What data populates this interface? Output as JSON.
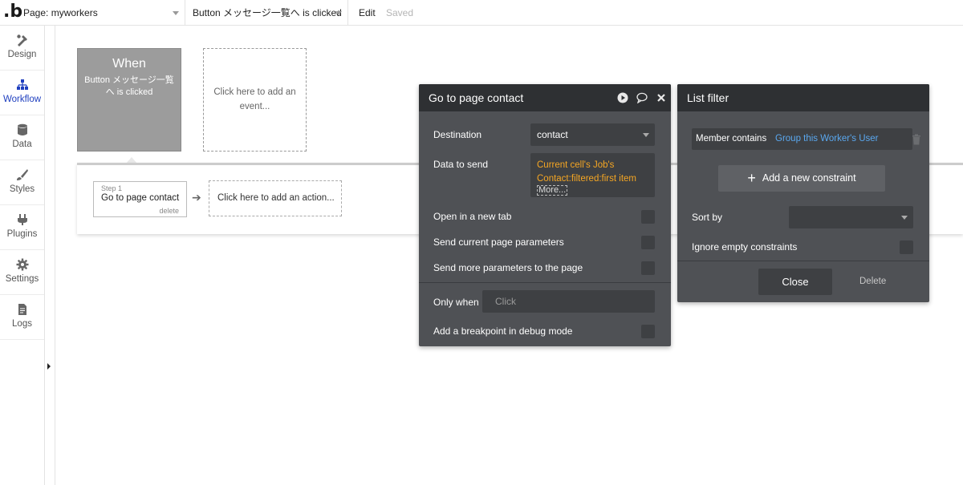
{
  "topbar": {
    "logo": ".b",
    "page_select": "Page: myworkers",
    "event_select": "Button メッセージ一覧へ is clicked",
    "edit_label": "Edit",
    "saved_label": "Saved"
  },
  "sidebar": {
    "items": [
      {
        "label": "Design",
        "icon": "design-icon"
      },
      {
        "label": "Workflow",
        "icon": "workflow-icon",
        "active": true
      },
      {
        "label": "Data",
        "icon": "database-icon"
      },
      {
        "label": "Styles",
        "icon": "brush-icon"
      },
      {
        "label": "Plugins",
        "icon": "plug-icon"
      },
      {
        "label": "Settings",
        "icon": "gear-icon"
      },
      {
        "label": "Logs",
        "icon": "document-icon"
      }
    ]
  },
  "canvas": {
    "event_when": "When",
    "event_name": "Button メッセージ一覧へ is clicked",
    "add_event": "Click here to add an event...",
    "step_number": "Step 1",
    "step_name": "Go to page contact",
    "step_delete": "delete",
    "add_action": "Click here to add an action..."
  },
  "action_panel": {
    "title": "Go to page contact",
    "destination_label": "Destination",
    "destination_value": "contact",
    "data_label": "Data to send",
    "data_value_line1": "Current cell's Job's",
    "data_value_line2": "Contact:filtered:first item",
    "data_more": "More...",
    "open_new_tab": "Open in a new tab",
    "send_params": "Send current page parameters",
    "send_more_params": "Send more parameters to the page",
    "only_when_label": "Only when",
    "only_when_placeholder": "Click",
    "breakpoint": "Add a breakpoint in debug mode"
  },
  "filter_panel": {
    "title": "List filter",
    "constraint_key": "Member contains",
    "constraint_value": "Group this Worker's User",
    "add_constraint": "Add a new constraint",
    "sort_by_label": "Sort by",
    "ignore_empty": "Ignore empty constraints",
    "close_label": "Close",
    "delete_label": "Delete"
  },
  "colors": {
    "panel_bg": "#4f5155",
    "panel_header": "#2e3033",
    "expression_orange": "#f5a623",
    "link_blue": "#5aa8f0",
    "active_nav": "#1f3fbf"
  }
}
